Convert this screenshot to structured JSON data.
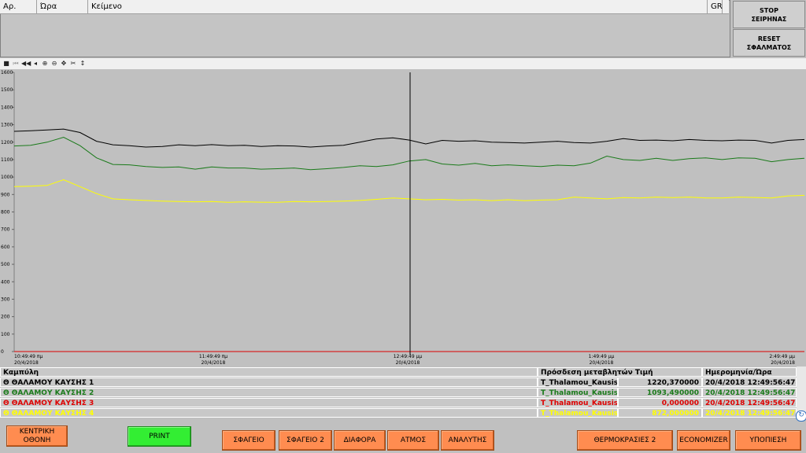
{
  "alarm_panel": {
    "columns": [
      "Αρ.",
      "Ώρα",
      "Κείμενο",
      "GR"
    ],
    "stop_button": "STOP\nΣΕΙΡΗΝΑΣ",
    "reset_button": "RESET\nΣΦΑΛΜΑΤΟΣ"
  },
  "toolbar": {
    "icons": [
      "stop-icon",
      "first-page-icon",
      "previous-icon",
      "step-back-icon",
      "zoom-in-icon",
      "zoom-out-icon",
      "pan-icon",
      "scissors-icon",
      "cursor-icon",
      "ruler-icon"
    ]
  },
  "chart_data": {
    "type": "line",
    "ylim": [
      0,
      1600
    ],
    "yticks": [
      "1600",
      "1500",
      "1400",
      "1300",
      "1200",
      "1100",
      "1000",
      "900",
      "800",
      "700",
      "600",
      "500",
      "400",
      "300",
      "200",
      "100",
      "0"
    ],
    "xticks": [
      {
        "time": "10:49:49 πμ",
        "date": "20/4/2018"
      },
      {
        "time": "11:49:49 πμ",
        "date": "20/4/2018"
      },
      {
        "time": "12:49:49 μμ",
        "date": "20/4/2018"
      },
      {
        "time": "1:49:49 μμ",
        "date": "20/4/2018"
      },
      {
        "time": "2:49:49 μμ",
        "date": "20/4/2018"
      }
    ],
    "x_minutes": [
      0,
      5,
      10,
      15,
      20,
      25,
      30,
      35,
      40,
      45,
      50,
      55,
      60,
      65,
      70,
      75,
      80,
      85,
      90,
      95,
      100,
      105,
      110,
      115,
      120,
      125,
      130,
      135,
      140,
      145,
      150,
      155,
      160,
      165,
      170,
      175,
      180,
      185,
      190,
      195,
      200,
      205,
      210,
      215,
      220,
      225,
      230,
      235,
      240
    ],
    "series": [
      {
        "color": "#000000",
        "values": [
          1262,
          1265,
          1270,
          1275,
          1255,
          1205,
          1185,
          1180,
          1172,
          1175,
          1185,
          1180,
          1186,
          1180,
          1182,
          1175,
          1180,
          1178,
          1172,
          1178,
          1182,
          1200,
          1218,
          1225,
          1212,
          1190,
          1210,
          1205,
          1208,
          1200,
          1198,
          1195,
          1200,
          1205,
          1198,
          1195,
          1205,
          1220,
          1210,
          1212,
          1208,
          1215,
          1210,
          1208,
          1212,
          1210,
          1195,
          1210,
          1215
        ]
      },
      {
        "color": "#1a7a1a",
        "values": [
          1178,
          1182,
          1200,
          1228,
          1180,
          1110,
          1072,
          1070,
          1060,
          1055,
          1058,
          1045,
          1058,
          1052,
          1052,
          1045,
          1048,
          1052,
          1042,
          1048,
          1055,
          1065,
          1060,
          1070,
          1092,
          1100,
          1075,
          1068,
          1078,
          1065,
          1070,
          1065,
          1060,
          1068,
          1065,
          1080,
          1120,
          1100,
          1095,
          1108,
          1095,
          1105,
          1110,
          1100,
          1110,
          1108,
          1088,
          1100,
          1108
        ]
      },
      {
        "color": "#dd0000",
        "values": [
          0,
          0,
          0,
          0,
          0,
          0,
          0,
          0,
          0,
          0,
          0,
          0,
          0,
          0,
          0,
          0,
          0,
          0,
          0,
          0,
          0,
          0,
          0,
          0,
          0,
          0,
          0,
          0,
          0,
          0,
          0,
          0,
          0,
          0,
          0,
          0,
          0,
          0,
          0,
          0,
          0,
          0,
          0,
          0,
          0,
          0,
          0,
          0,
          0
        ]
      },
      {
        "color": "#ffff00",
        "values": [
          945,
          948,
          952,
          985,
          945,
          905,
          875,
          870,
          866,
          862,
          860,
          858,
          860,
          855,
          858,
          856,
          855,
          860,
          858,
          860,
          862,
          866,
          872,
          880,
          875,
          870,
          872,
          868,
          870,
          865,
          870,
          865,
          868,
          870,
          885,
          880,
          875,
          882,
          880,
          885,
          882,
          885,
          880,
          880,
          885,
          883,
          880,
          892,
          895
        ]
      }
    ]
  },
  "legend": {
    "headers": [
      "Καμπύλη",
      "Πρόσδεση μεταβλητών Τιμή",
      "",
      "Ημερομηνία/Ώρα"
    ],
    "rows": [
      {
        "name": "Θ ΘΑΛΑΜΟΥ ΚΑΥΣΗΣ 1",
        "tag": "T_Thalamou_Kausis...",
        "value": "1220,370000",
        "datetime": "20/4/2018 12:49:56:474...",
        "color": "#000000"
      },
      {
        "name": "Θ ΘΑΛΑΜΟΥ ΚΑΥΣΗΣ 2",
        "tag": "T_Thalamou_Kausis...",
        "value": "1093,490000",
        "datetime": "20/4/2018 12:49:56:474...",
        "color": "#1a7a1a"
      },
      {
        "name": "Θ ΘΑΛΑΜΟΥ ΚΑΥΣΗΣ 3",
        "tag": "T_Thalamou_Kausis...",
        "value": "0,000000",
        "datetime": "20/4/2018 12:49:56:474...",
        "color": "#dd0000"
      },
      {
        "name": "Θ ΘΑΛΑΜΟΥ ΚΑΥΣΗΣ 4",
        "tag": "T_Thalamou_Kausis...",
        "value": "872,000000",
        "datetime": "20/4/2018 12:49:56:474...",
        "color": "#ffff00"
      }
    ]
  },
  "nav": {
    "main_screen": "ΚΕΝΤΡΙΚΗ\nΟΘΟΝΗ",
    "print": "PRINT",
    "sfageio": "ΣΦΑΓΕΙΟ",
    "sfageio2": "ΣΦΑΓΕΙΟ 2",
    "diafora": "ΔΙΑΦΟΡΑ",
    "atmos": "ΑΤΜΟΣ",
    "analytis": "ΑΝΑΛΥΤΗΣ",
    "thermokrasies2": "ΘΕΡΜΟΚΡΑΣΙΕΣ 2",
    "economizer": "ECONOMIZER",
    "ypopiesi": "ΥΠΟΠΙΕΣΗ"
  }
}
